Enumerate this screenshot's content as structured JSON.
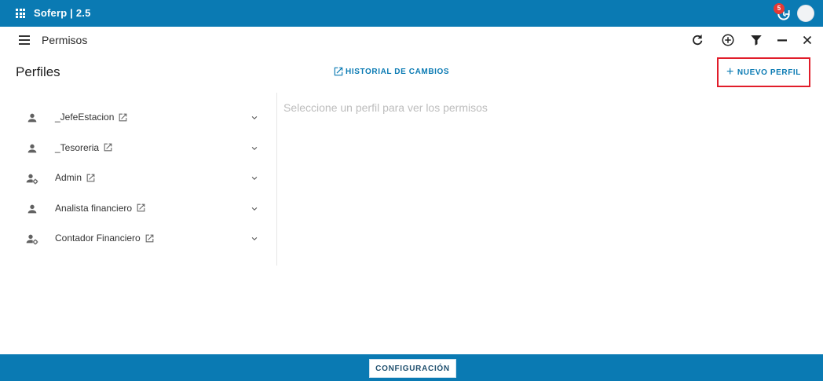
{
  "app": {
    "title": "Soferp | 2.5",
    "accent": "#0a7ab3",
    "notification_count": "5"
  },
  "header": {
    "title": "Permisos",
    "tools": [
      "refresh-icon",
      "add-circle-icon",
      "filter-icon",
      "minimize-icon",
      "close-icon"
    ]
  },
  "main": {
    "section_title": "Perfiles",
    "history_label": "HISTORIAL DE CAMBIOS",
    "new_profile_label": "NUEVO PERFIL",
    "placeholder": "Seleccione un perfil para ver los permisos"
  },
  "profiles": [
    {
      "name": "_JefeEstacion",
      "icon": "person-icon"
    },
    {
      "name": "_Tesoreria",
      "icon": "person-icon"
    },
    {
      "name": "Admin",
      "icon": "person-settings-icon"
    },
    {
      "name": "Analista financiero",
      "icon": "person-icon"
    },
    {
      "name": "Contador Financiero",
      "icon": "person-settings-icon"
    }
  ],
  "footer": {
    "config_label": "CONFIGURACIÓN"
  }
}
